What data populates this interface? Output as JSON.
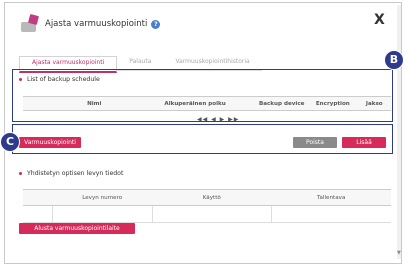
{
  "dialog": {
    "title": "Ajasta varmuuskopiointi",
    "close": "X"
  },
  "tabs": [
    {
      "label": "Ajasta varmuuskopiointi"
    },
    {
      "label": "Palauta"
    },
    {
      "label": "Varmuuskopiointihistoria"
    }
  ],
  "schedule": {
    "section_title": "List of backup schedule",
    "columns": [
      "Nimi",
      "Alkuperäinen polku",
      "Backup device",
      "Encryption",
      "Jakso"
    ],
    "pager": "◀◀ ◀ ▶ ▶▶"
  },
  "actions": {
    "backup_label": "Varmuuskopiointi",
    "delete_label": "Poista",
    "add_label": "Lisää"
  },
  "optical": {
    "section_title": "Yhdistetyn optisen levyn tiedot",
    "columns": [
      "Levyn numero",
      "Käyttö",
      "Tallentava"
    ],
    "init_button": "Alusta varmuuskopiointilaite"
  },
  "markers": {
    "b": "B",
    "c": "C"
  },
  "colors": {
    "accent": "#d62b5a",
    "annotation": "#2e3a8c"
  }
}
